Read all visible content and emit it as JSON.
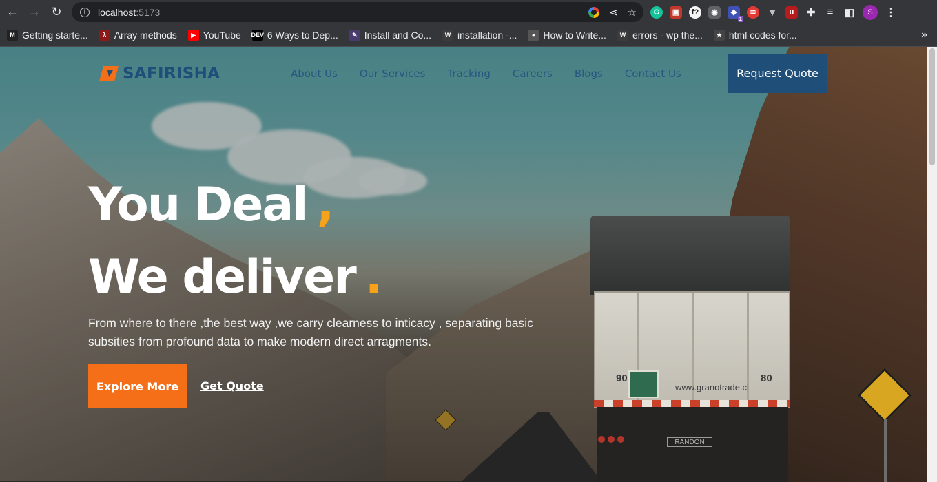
{
  "browser": {
    "url_host": "localhost",
    "url_port": ":5173",
    "extension_badge": "1",
    "profile_initial": "S",
    "bookmarks": [
      {
        "label": "Getting starte...",
        "icon_text": "M",
        "color": "#222222"
      },
      {
        "label": "Array methods",
        "icon_text": "λ",
        "color": "#8b1a1a"
      },
      {
        "label": "YouTube",
        "icon_text": "▶",
        "color": "#ff0000"
      },
      {
        "label": "6 Ways to Dep...",
        "icon_text": "DEV",
        "color": "#000000"
      },
      {
        "label": "Install and Co...",
        "icon_text": "✎",
        "color": "#4a3b6e"
      },
      {
        "label": "installation -...",
        "icon_text": "W",
        "color": "#3c3c3c"
      },
      {
        "label": "How to Write...",
        "icon_text": "●",
        "color": "#555555"
      },
      {
        "label": "errors - wp the...",
        "icon_text": "W",
        "color": "#3c3c3c"
      },
      {
        "label": "html codes for...",
        "icon_text": "★",
        "color": "#444444"
      }
    ],
    "more_bookmarks": "»"
  },
  "site": {
    "logo_text": "SAFIRISHA",
    "nav": [
      "About Us",
      "Our Services",
      "Tracking",
      "Careers",
      "Blogs",
      "Contact Us"
    ],
    "request_quote": "Request Quote"
  },
  "hero": {
    "line1": "You Deal",
    "line1_accent": ",",
    "line2": "We deliver",
    "line2_accent": ".",
    "description": "From where to there ,the best way ,we carry clearness to inticacy , separating basic subsities from profound data to make modern direct arragments.",
    "explore_button": "Explore More",
    "get_quote_link": "Get Quote"
  },
  "scene": {
    "truck_left_number": "90",
    "truck_right_number": "80",
    "truck_website": "www.granotrade.cl",
    "truck_plate": "RANDON"
  },
  "colors": {
    "brand_navy": "#1f4e79",
    "accent_orange": "#f46f17",
    "accent_gold": "#f7a21b"
  }
}
